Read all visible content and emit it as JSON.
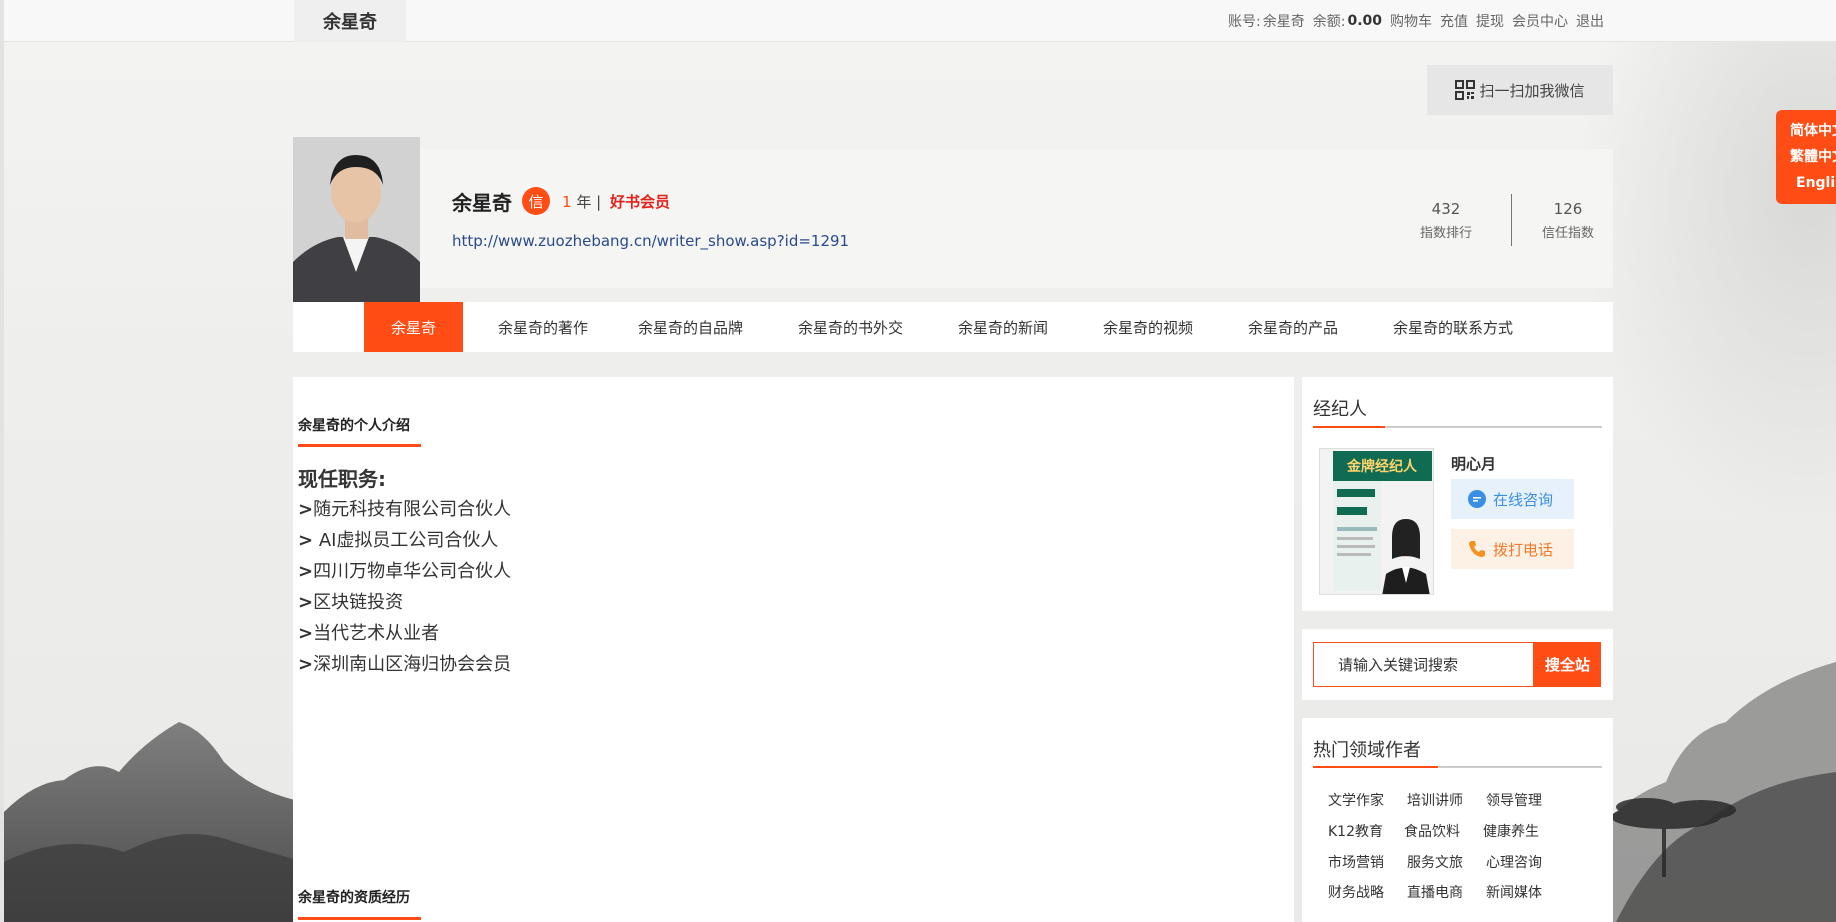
{
  "topbar": {
    "brand": "余星奇",
    "account_label": "账号:",
    "account_name": "余星奇",
    "balance_label": "余额:",
    "balance_value": "0.00",
    "links": [
      "购物车",
      "充值",
      "提现",
      "会员中心",
      "退出"
    ]
  },
  "wechat": {
    "label": "扫一扫加我微信"
  },
  "language": [
    "简体中文",
    "繁體中文",
    "English"
  ],
  "profile": {
    "name": "余星奇",
    "badge": "信",
    "years_num": "1",
    "years_unit": " 年 |",
    "member": "好书会员",
    "url": "http://www.zuozhebang.cn/writer_show.asp?id=1291",
    "stats": [
      {
        "value": "432",
        "label": "指数排行"
      },
      {
        "value": "126",
        "label": "信任指数"
      }
    ]
  },
  "nav": [
    "余星奇",
    "余星奇的著作",
    "余星奇的自品牌",
    "余星奇的书外交",
    "余星奇的新闻",
    "余星奇的视频",
    "余星奇的产品",
    "余星奇的联系方式"
  ],
  "main": {
    "intro_title": "余星奇的个人介绍",
    "intro_heading": "现任职务:",
    "intro_items": [
      "随元科技有限公司合伙人",
      " AI虚拟员工公司合伙人",
      "四川万物卓华公司合伙人",
      "区块链投资",
      "当代艺术从业者",
      "深圳南山区海归协会会员"
    ],
    "credentials_title": "余星奇的资质经历"
  },
  "sidebar": {
    "agent_title": "经纪人",
    "agent_name": "明心月",
    "consult_label": "在线咨询",
    "call_label": "拨打电话",
    "agent_poster_title": "金牌经纪人",
    "search_placeholder": "请输入关键词搜索",
    "search_button": "搜全站",
    "hot_title": "热门领域作者",
    "hot_items": [
      "文学作家",
      "培训讲师",
      "领导管理",
      "K12教育",
      "食品饮料",
      "健康养生",
      "市场营销",
      "服务文旅",
      "心理咨询",
      "财务战略",
      "直播电商",
      "新闻媒体"
    ]
  },
  "colors": {
    "accent": "#ff4d15",
    "link": "#2a4a8a",
    "member": "#e2231a"
  }
}
